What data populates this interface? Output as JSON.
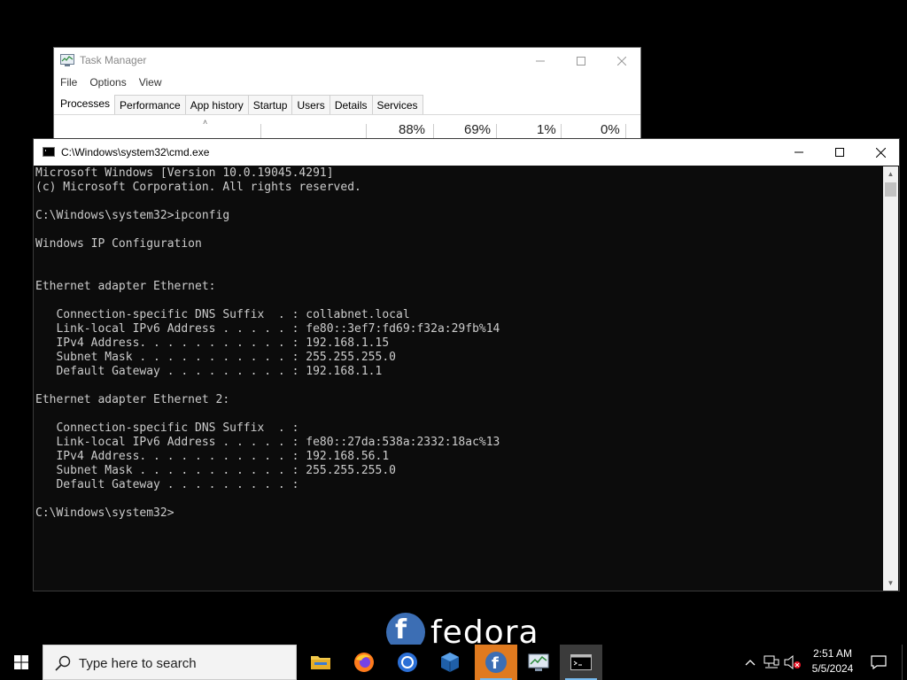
{
  "task_manager": {
    "title": "Task Manager",
    "menu": [
      "File",
      "Options",
      "View"
    ],
    "tabs": [
      "Processes",
      "Performance",
      "App history",
      "Startup",
      "Users",
      "Details",
      "Services"
    ],
    "active_tab": "Processes",
    "column_values": [
      "88%",
      "69%",
      "1%",
      "0%"
    ]
  },
  "cmd": {
    "title": "C:\\Windows\\system32\\cmd.exe",
    "lines": [
      "Microsoft Windows [Version 10.0.19045.4291]",
      "(c) Microsoft Corporation. All rights reserved.",
      "",
      "C:\\Windows\\system32>ipconfig",
      "",
      "Windows IP Configuration",
      "",
      "",
      "Ethernet adapter Ethernet:",
      "",
      "   Connection-specific DNS Suffix  . : collabnet.local",
      "   Link-local IPv6 Address . . . . . : fe80::3ef7:fd69:f32a:29fb%14",
      "   IPv4 Address. . . . . . . . . . . : 192.168.1.15",
      "   Subnet Mask . . . . . . . . . . . : 255.255.255.0",
      "   Default Gateway . . . . . . . . . : 192.168.1.1",
      "",
      "Ethernet adapter Ethernet 2:",
      "",
      "   Connection-specific DNS Suffix  . :",
      "   Link-local IPv6 Address . . . . . : fe80::27da:538a:2332:18ac%13",
      "   IPv4 Address. . . . . . . . . . . : 192.168.56.1",
      "   Subnet Mask . . . . . . . . . . . : 255.255.255.0",
      "   Default Gateway . . . . . . . . . :",
      "",
      "C:\\Windows\\system32>"
    ]
  },
  "desktop": {
    "watermark": "fedora"
  },
  "taskbar": {
    "search_placeholder": "Type here to search",
    "apps": [
      "file-explorer",
      "firefox",
      "chrome",
      "virtualbox",
      "fedora-media-writer",
      "task-manager",
      "command-prompt"
    ],
    "clock_time": "2:51 AM",
    "clock_date": "5/5/2024"
  },
  "colors": {
    "console_bg": "#0c0c0c",
    "console_fg": "#cccccc",
    "fedora_blue": "#3c6eb4",
    "taskbar_accent": "#76b9ed"
  }
}
